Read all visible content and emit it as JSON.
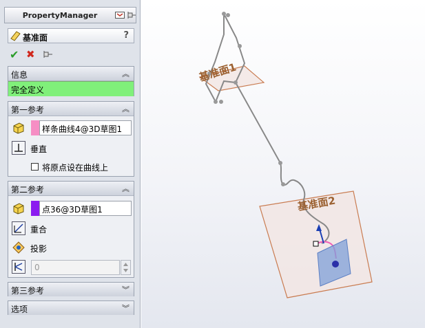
{
  "property_manager": {
    "title": "PropertyManager",
    "feature_name": "基准面",
    "help_glyph": "?"
  },
  "actions": {
    "ok_glyph": "✔",
    "cancel_glyph": "✖"
  },
  "info": {
    "header": "信息",
    "status": "完全定义",
    "status_color": "#80f07a"
  },
  "first_reference": {
    "header": "第一参考",
    "entity": "样条曲线4@3D草图1",
    "swatch_color": "#f68ec4",
    "constraint": "垂直",
    "option_label": "将原点设在曲线上",
    "option_checked": false
  },
  "second_reference": {
    "header": "第二参考",
    "entity": "点36@3D草图1",
    "swatch_color": "#8b1cf0",
    "constraint_1": "重合",
    "constraint_2": "投影",
    "angle_value": "0"
  },
  "third_reference": {
    "header": "第三参考"
  },
  "options": {
    "header": "选项"
  },
  "chevron_up": "︽",
  "chevron_down": "︾",
  "viewport": {
    "plane_1_label": "基准面1",
    "plane_2_label": "基准面2",
    "plane_color": "#c97b50",
    "label_color": "#9b6030"
  }
}
